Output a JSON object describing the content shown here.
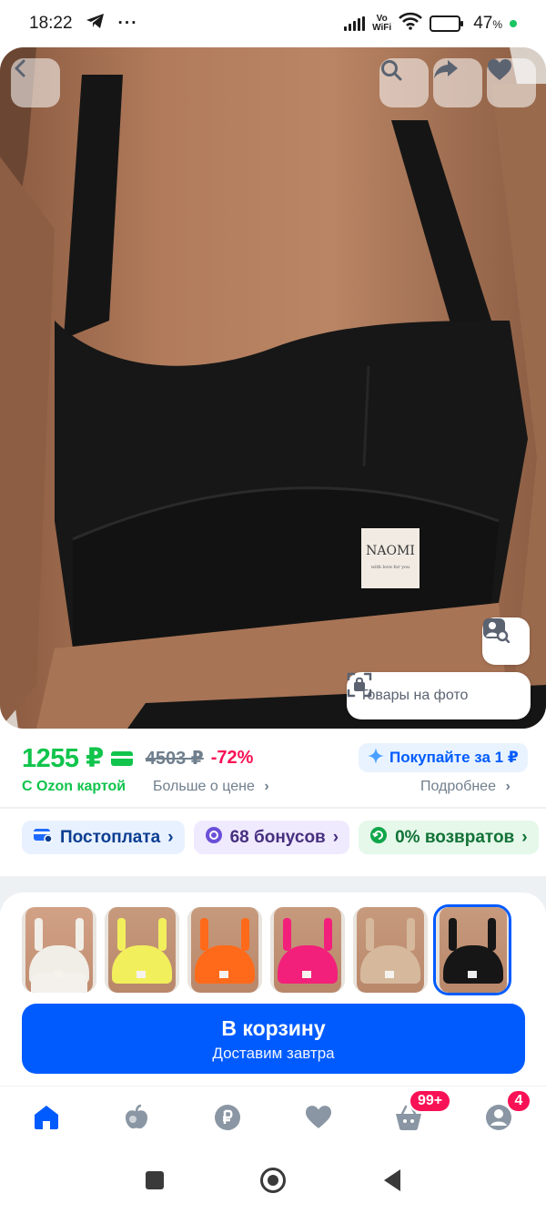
{
  "status_bar": {
    "time": "18:22",
    "more": "···",
    "network": "Vo\nWiFi",
    "battery": "47",
    "battery_unit": "%",
    "battery_level": 0.47
  },
  "photo": {
    "label_brand": "NAOMI",
    "label_tagline": "with love for you",
    "photo_items_chip": "Товары на фото"
  },
  "price": {
    "current": "1255 ₽",
    "old": "4503 ₽",
    "discount": "-72%",
    "card_note": "С Ozon картой",
    "more_about_price": "Больше о цене",
    "promo": "Покупайте за 1 ₽",
    "details": "Подробнее"
  },
  "chips": [
    {
      "label": "Постоплата"
    },
    {
      "label": "68 бонусов"
    },
    {
      "label": "0% возвратов"
    }
  ],
  "thumbnails": [
    {
      "name": "white",
      "color": "#f1ede7",
      "selected": false
    },
    {
      "name": "yellow",
      "color": "#f2ef5c",
      "selected": false
    },
    {
      "name": "orange",
      "color": "#ff6a1a",
      "selected": false
    },
    {
      "name": "pink",
      "color": "#f2207a",
      "selected": false
    },
    {
      "name": "beige",
      "color": "#d6b99c",
      "selected": false
    },
    {
      "name": "black",
      "color": "#161616",
      "selected": true
    }
  ],
  "cart_button": {
    "title": "В корзину",
    "subtitle": "Доставим завтра"
  },
  "bottom_nav": {
    "cart_badge": "99+",
    "profile_badge": "4"
  },
  "colors": {
    "accent": "#005bff",
    "price_green": "#10c44c",
    "discount_red": "#f91155"
  }
}
